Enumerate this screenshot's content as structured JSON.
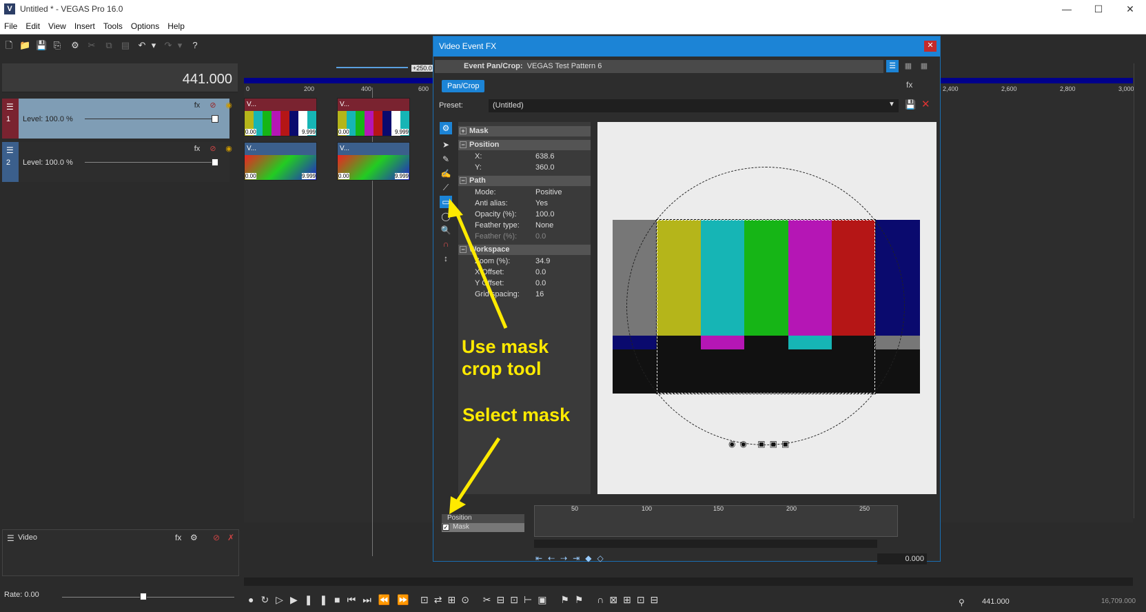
{
  "app": {
    "title": "Untitled * - VEGAS Pro 16.0",
    "logo": "V"
  },
  "window_controls": {
    "minimize": "—",
    "maximize": "☐",
    "close": "✕"
  },
  "menu": [
    "File",
    "Edit",
    "View",
    "Insert",
    "Tools",
    "Options",
    "Help"
  ],
  "timecode": "441.000",
  "tracks": [
    {
      "num": "1",
      "level": "Level: 100.0 %",
      "header_color": "#7a2330"
    },
    {
      "num": "2",
      "level": "Level: 100.0 %",
      "header_color": "#3b5f8c"
    }
  ],
  "ruler": {
    "marks": [
      "0",
      "200",
      "400",
      "600"
    ],
    "right_marks": [
      "2,400",
      "2,600",
      "2,800",
      "3,000"
    ],
    "zoom_label": "+250.0"
  },
  "clips": {
    "label": "V...",
    "start": "0.00",
    "end": "9.999"
  },
  "fx_window": {
    "title": "Video Event FX",
    "plugin_label": "Event Pan/Crop:",
    "plugin_name": "VEGAS Test Pattern 6",
    "tab": "Pan/Crop",
    "preset_label": "Preset:",
    "preset_value": "(Untitled)",
    "sections": {
      "mask": "Mask",
      "position": "Position",
      "path": "Path",
      "workspace": "Workspace"
    },
    "position": [
      {
        "k": "X:",
        "v": "638.6"
      },
      {
        "k": "Y:",
        "v": "360.0"
      }
    ],
    "path": [
      {
        "k": "Mode:",
        "v": "Positive"
      },
      {
        "k": "Anti alias:",
        "v": "Yes"
      },
      {
        "k": "Opacity (%):",
        "v": "100.0"
      },
      {
        "k": "Feather type:",
        "v": "None"
      },
      {
        "k": "Feather (%):",
        "v": "0.0"
      }
    ],
    "workspace": [
      {
        "k": "Zoom (%):",
        "v": "34.9"
      },
      {
        "k": "X Offset:",
        "v": "0.0"
      },
      {
        "k": "Y Offset:",
        "v": "0.0"
      },
      {
        "k": "Grid spacing:",
        "v": "16"
      }
    ],
    "kf_tracks": [
      "Position",
      "Mask"
    ],
    "kf_ruler": [
      "50",
      "100",
      "150",
      "200",
      "250"
    ],
    "kf_time": "0.000"
  },
  "annotations": {
    "crop": "Use mask crop tool",
    "mask": "Select mask"
  },
  "video_bus": {
    "label": "Video"
  },
  "rate": "Rate: 0.00",
  "status": {
    "time": "441.000",
    "end": "16,709.000"
  },
  "bar_colors": [
    "#b5b51a",
    "#16b5b5",
    "#16b516",
    "#b516b5",
    "#b51616",
    "#0a0a6e"
  ]
}
